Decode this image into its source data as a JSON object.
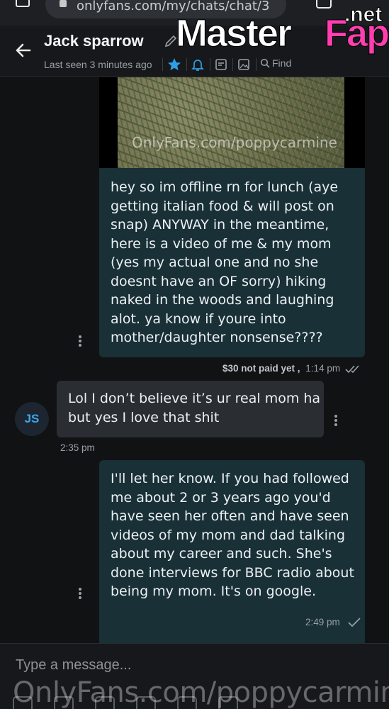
{
  "browser": {
    "url": "onlyfans.com/my/chats/chat/3"
  },
  "header": {
    "contact_name": "Jack sparrow",
    "last_seen": "Last seen 3 minutes ago",
    "find_label": "Find"
  },
  "logo": {
    "word1": "Master",
    "word2": "Fap",
    "suffix": ".net"
  },
  "media": {
    "watermark": "OnlyFans.com/poppycarmine"
  },
  "messages": [
    {
      "direction": "outgoing",
      "lines": [
        "hey so im offline rn for lunch (aye",
        "getting italian food & will post on",
        "snap) ANYWAY in the meantime,",
        "here is a video of me & my mom",
        "(yes my actual one and no she",
        "doesnt have an OF sorry) hiking",
        "naked in the woods and laughing",
        "alot. ya know if youre into",
        "mother/daughter nonsense????"
      ],
      "price": "$30 not paid yet ,",
      "time": "1:14 pm"
    },
    {
      "direction": "incoming",
      "avatar_initials": "JS",
      "lines": [
        "Lol I don’t believe it’s ur real mom ha",
        "but yes I love that shit"
      ],
      "time": "2:35 pm"
    },
    {
      "direction": "outgoing",
      "lines": [
        "I'll let her know. If you had followed",
        "me about 2 or 3 years ago you'd",
        "have seen her often and have seen",
        "videos of my mom and dad talking",
        "about my career and such. She's",
        "done interviews for BBC radio about",
        "being my mom. It's on google."
      ],
      "time": "2:49 pm"
    }
  ],
  "composer": {
    "placeholder": "Type a message..."
  },
  "watermark": "OnlyFans.com/poppycarmine",
  "colors": {
    "background": "#111214",
    "outgoing_bubble": "#183036",
    "incoming_bubble": "#2a2d31",
    "accent": "#3aa9e8"
  }
}
